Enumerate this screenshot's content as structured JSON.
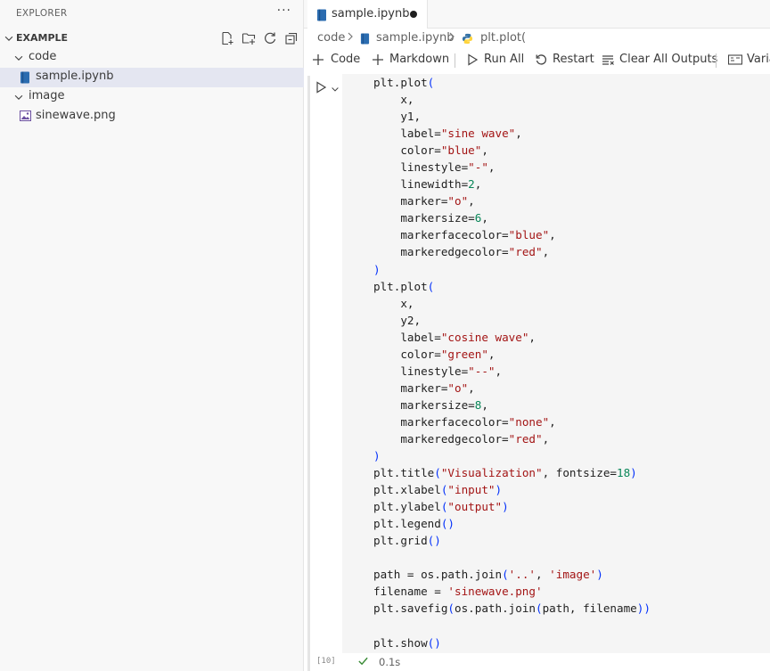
{
  "explorer": {
    "title": "EXPLORER",
    "more": "···",
    "section": "EXAMPLE",
    "tree": [
      {
        "label": "code",
        "type": "folder"
      },
      {
        "label": "sample.ipynb",
        "type": "notebook"
      },
      {
        "label": "image",
        "type": "folder"
      },
      {
        "label": "sinewave.png",
        "type": "image"
      }
    ]
  },
  "tab": {
    "label": "sample.ipynb",
    "modified": true
  },
  "breadcrumb": [
    "code",
    "sample.ipynb",
    "plt.plot("
  ],
  "toolbar": {
    "code": "Code",
    "markdown": "Markdown",
    "run_all": "Run All",
    "restart": "Restart",
    "clear_all": "Clear All Outputs",
    "variables": "Variables"
  },
  "cell": {
    "exec_count": "[10]",
    "duration": "0.1s",
    "lines": [
      "plt.plot(",
      "    x,",
      "    y1,",
      "    label=\"sine wave\",",
      "    color=\"blue\",",
      "    linestyle=\"-\",",
      "    linewidth=2,",
      "    marker=\"o\",",
      "    markersize=6,",
      "    markerfacecolor=\"blue\",",
      "    markeredgecolor=\"red\",",
      ")",
      "plt.plot(",
      "    x,",
      "    y2,",
      "    label=\"cosine wave\",",
      "    color=\"green\",",
      "    linestyle=\"--\",",
      "    marker=\"o\",",
      "    markersize=8,",
      "    markerfacecolor=\"none\",",
      "    markeredgecolor=\"red\",",
      ")",
      "plt.title(\"Visualization\", fontsize=18)",
      "plt.xlabel(\"input\")",
      "plt.ylabel(\"output\")",
      "plt.legend()",
      "plt.grid()",
      "",
      "path = os.path.join('..', 'image')",
      "filename = 'sinewave.png'",
      "plt.savefig(os.path.join(path, filename))",
      "",
      "plt.show()"
    ]
  },
  "colors": {
    "accent": "#005fb8",
    "selection": "#e4e6f1",
    "string": "#a31515",
    "number": "#098658",
    "bracket": "#0431fa",
    "success": "#388a34"
  }
}
